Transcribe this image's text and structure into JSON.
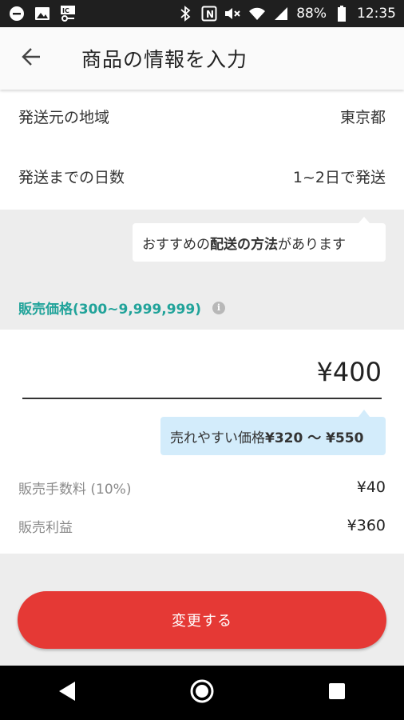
{
  "status_bar": {
    "battery": "88%",
    "time": "12:35",
    "left_icons": [
      "minus-circle-icon",
      "image-icon",
      "ic-key-icon"
    ],
    "right_icons": [
      "bluetooth-icon",
      "nfc-icon",
      "mute-icon",
      "wifi-icon",
      "signal-icon",
      "battery-icon"
    ]
  },
  "header": {
    "title": "商品の情報を入力",
    "back_icon": "arrow-left-icon"
  },
  "shipping": {
    "origin_label": "発送元の地域",
    "origin_value": "東京都",
    "days_label": "発送までの日数",
    "days_value": "1~2日で発送",
    "tip_prefix": "おすすめの",
    "tip_bold": "配送の方法",
    "tip_suffix": "があります"
  },
  "price": {
    "section_label": "販売価格(300~9,999,999)",
    "value": "¥400",
    "suggest_prefix": "売れやすい価格 ",
    "suggest_range": "¥320 〜 ¥550",
    "fee_label": "販売手数料 (10%)",
    "fee_value": "¥40",
    "profit_label": "販売利益",
    "profit_value": "¥360"
  },
  "actions": {
    "submit_label": "変更する"
  },
  "colors": {
    "accent_teal": "#21a39a",
    "button_red": "#e53935",
    "suggest_bg": "#d3ecfb"
  }
}
